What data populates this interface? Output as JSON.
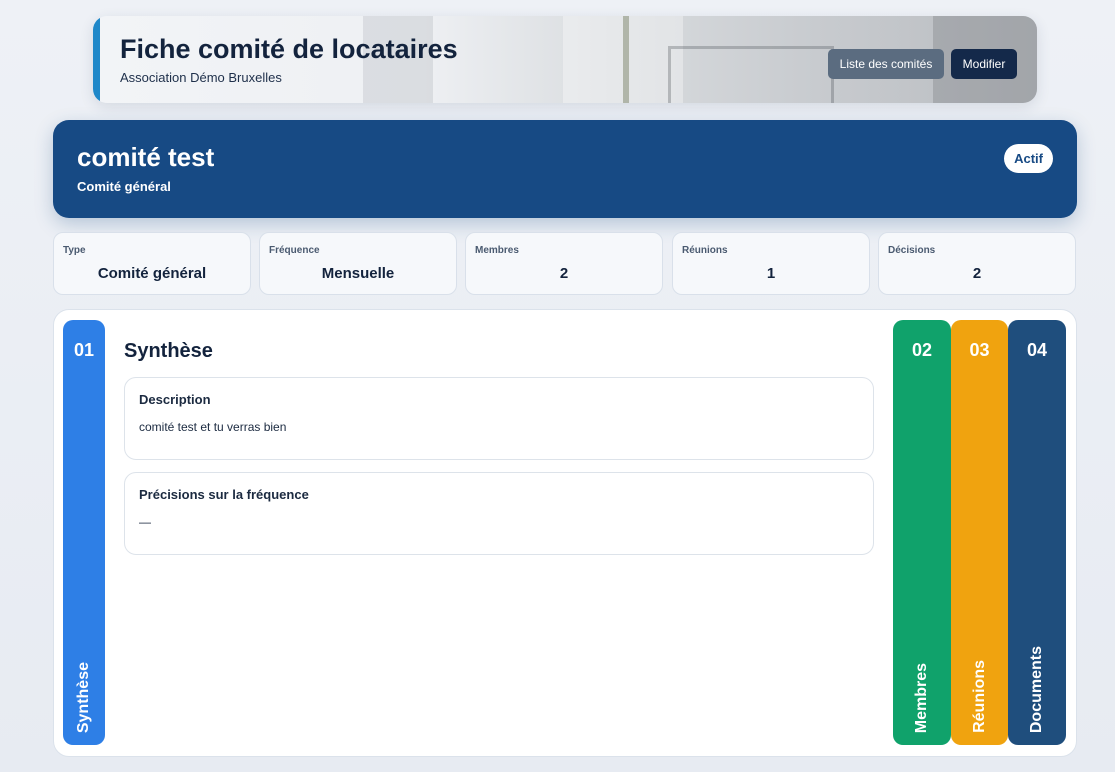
{
  "header": {
    "title": "Fiche comité de locataires",
    "subtitle": "Association Démo Bruxelles",
    "buttons": {
      "list": "Liste des comités",
      "edit": "Modifier"
    }
  },
  "committee": {
    "name": "comité test",
    "type_label": "Comité général",
    "status": "Actif"
  },
  "stats": [
    {
      "label": "Type",
      "value": "Comité général"
    },
    {
      "label": "Fréquence",
      "value": "Mensuelle"
    },
    {
      "label": "Membres",
      "value": "2"
    },
    {
      "label": "Réunions",
      "value": "1"
    },
    {
      "label": "Décisions",
      "value": "2"
    }
  ],
  "tabs": [
    {
      "num": "01",
      "label": "Synthèse",
      "color": "#2e7fe6"
    },
    {
      "num": "02",
      "label": "Membres",
      "color": "#10a26b"
    },
    {
      "num": "03",
      "label": "Réunions",
      "color": "#f0a30f"
    },
    {
      "num": "04",
      "label": "Documents",
      "color": "#1f4e7d"
    }
  ],
  "synthese": {
    "title": "Synthèse",
    "description": {
      "label": "Description",
      "value": "comité test et tu verras bien"
    },
    "frequency_details": {
      "label": "Précisions sur la fréquence",
      "value": "—"
    }
  },
  "colors": {
    "accent": "#1f88c9",
    "banner": "#174a84",
    "button_dark": "#14294a",
    "button_grey": "#5b6c80"
  }
}
